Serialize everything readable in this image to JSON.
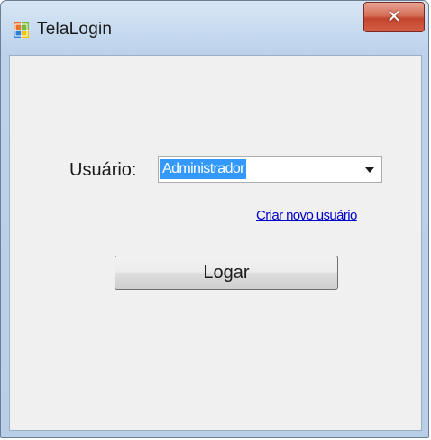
{
  "window": {
    "title": "TelaLogin",
    "icon": "windows-form-icon",
    "close_icon": "close-icon"
  },
  "form": {
    "user_label": "Usuário:",
    "user_select": {
      "selected_value": "Administrador"
    },
    "create_user_link": "Criar novo usuário",
    "login_button": "Logar"
  },
  "colors": {
    "selection": "#3399ff",
    "link": "#0000cc",
    "close_button": "#c2442c"
  }
}
